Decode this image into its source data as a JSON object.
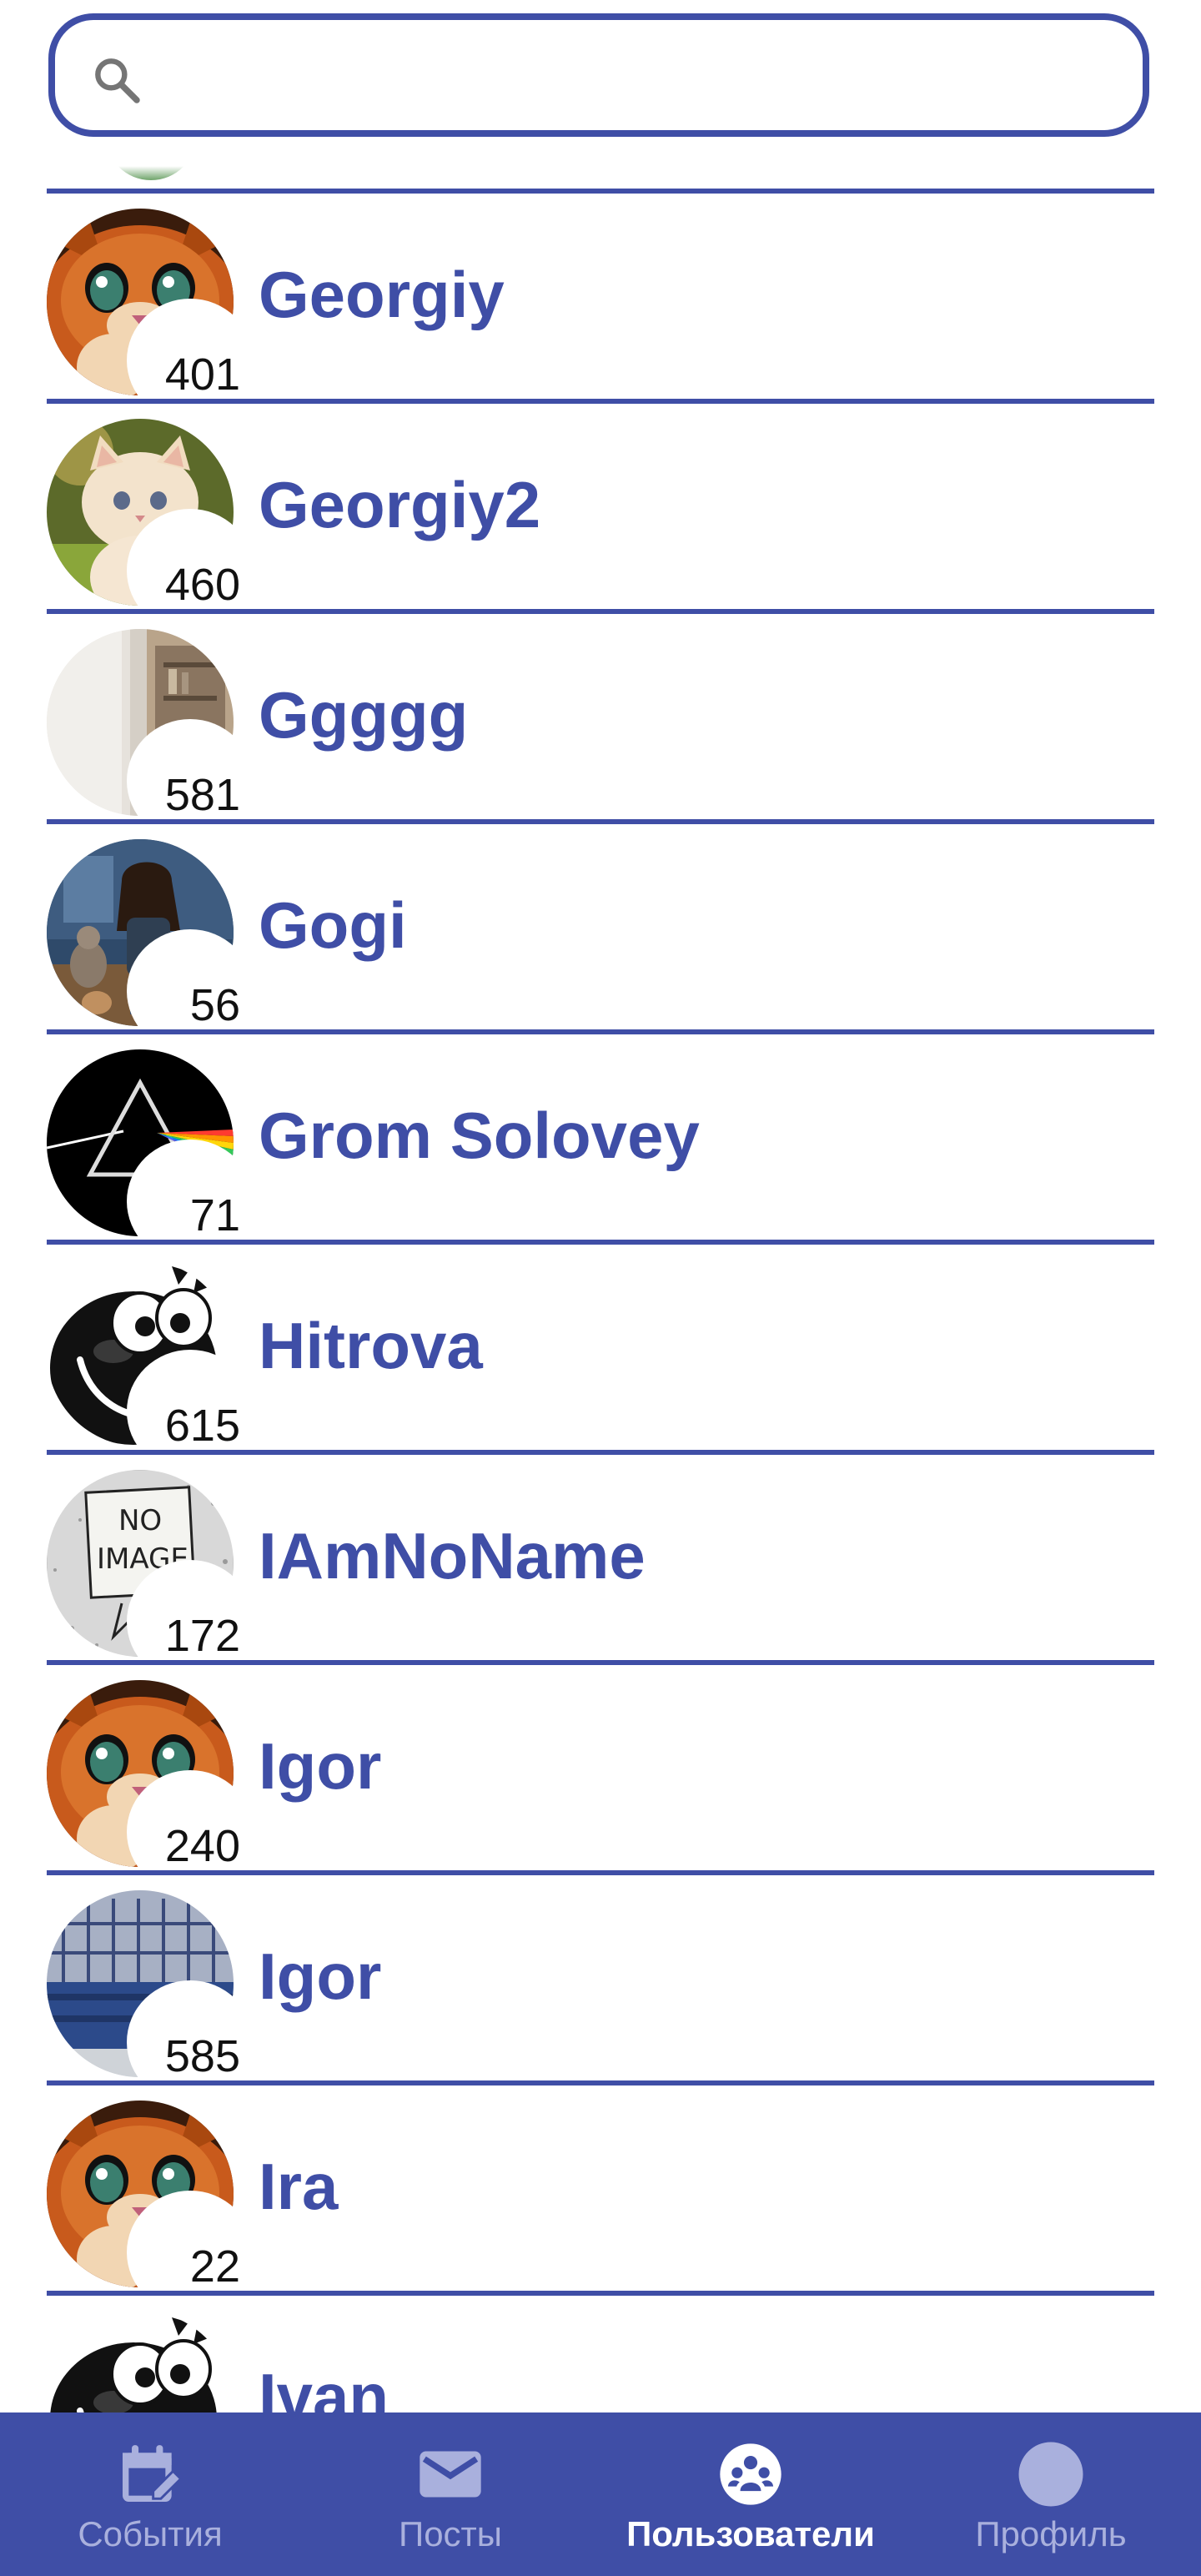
{
  "search": {
    "value": "",
    "placeholder": ""
  },
  "users": [
    {
      "name": "Georgiy",
      "count": "401",
      "avatar": "orange-cat"
    },
    {
      "name": "Georgiy2",
      "count": "460",
      "avatar": "white-kitten"
    },
    {
      "name": "Ggggg",
      "count": "581",
      "avatar": "room-interior"
    },
    {
      "name": "Gogi",
      "count": "56",
      "avatar": "man-with-cats"
    },
    {
      "name": "Grom Solovey",
      "count": "71",
      "avatar": "prism"
    },
    {
      "name": "Hitrova",
      "count": "615",
      "avatar": "black-smiley"
    },
    {
      "name": "IAmNoName",
      "count": "172",
      "avatar": "no-image-sign"
    },
    {
      "name": "Igor",
      "count": "240",
      "avatar": "orange-cat"
    },
    {
      "name": "Igor",
      "count": "585",
      "avatar": "crates"
    },
    {
      "name": "Ira",
      "count": "22",
      "avatar": "orange-cat"
    },
    {
      "name": "Ivan",
      "count": "",
      "avatar": "black-smiley"
    }
  ],
  "nav": {
    "items": [
      {
        "label": "События",
        "icon": "calendar-edit-icon",
        "active": false
      },
      {
        "label": "Посты",
        "icon": "mail-icon",
        "active": false
      },
      {
        "label": "Пользователи",
        "icon": "users-group-icon",
        "active": true
      },
      {
        "label": "Профиль",
        "icon": "profile-avatar-icon",
        "active": false
      }
    ]
  },
  "colors": {
    "accent": "#3F4EA6",
    "nav_inactive": "#A9B0DD",
    "background": "#FFFFFF"
  }
}
